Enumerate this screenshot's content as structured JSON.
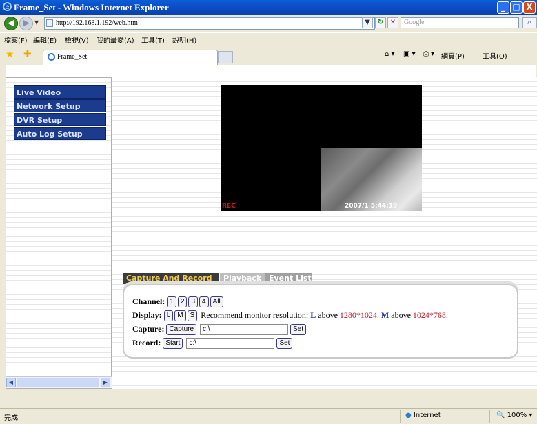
{
  "window": {
    "title": "Frame_Set - Windows Internet Explorer",
    "min": "_",
    "max": "□",
    "close": "X"
  },
  "address": {
    "url": "http://192.168.1.192/web.htm",
    "search_placeholder": "Google"
  },
  "menubar": [
    "檔案(F)",
    "編輯(E)",
    "檢視(V)",
    "我的最愛(A)",
    "工具(T)",
    "說明(H)"
  ],
  "tab": {
    "label": "Frame_Set"
  },
  "commandbar": {
    "page": "網頁(P)",
    "tools": "工具(O)"
  },
  "sidebar": {
    "items": [
      {
        "label": "Live Video"
      },
      {
        "label": "Network Setup"
      },
      {
        "label": "DVR Setup"
      },
      {
        "label": "Auto Log Setup"
      }
    ]
  },
  "video": {
    "rec": "REC",
    "timestamp": "2007/1 5:44:19"
  },
  "tabs": [
    {
      "label": "Capture And Record",
      "active": true
    },
    {
      "label": "Playback",
      "active": false
    },
    {
      "label": "Event List",
      "active": false
    }
  ],
  "panel": {
    "channel_label": "Channel:",
    "channel_buttons": [
      "1",
      "2",
      "3",
      "4",
      "All"
    ],
    "display_label": "Display:",
    "display_buttons": [
      "L",
      "M",
      "S"
    ],
    "recommend_prefix": "Recommend monitor resolution:",
    "rec_L": "L",
    "above1": "above",
    "res1": "1280*1024.",
    "rec_M": "M",
    "above2": "above",
    "res2": "1024*768.",
    "capture_label": "Capture:",
    "capture_button": "Capture",
    "capture_path": "c:\\",
    "capture_set": "Set",
    "record_label": "Record:",
    "record_button": "Start",
    "record_path": "c:\\",
    "record_set": "Set"
  },
  "status": {
    "text": "完成",
    "zone": "Internet",
    "zoom": "100%"
  },
  "colors": {
    "sidebar_bg": "#1b3b8e",
    "tab_active_text": "#f3d04a",
    "resolution_red": "#c0182b"
  }
}
